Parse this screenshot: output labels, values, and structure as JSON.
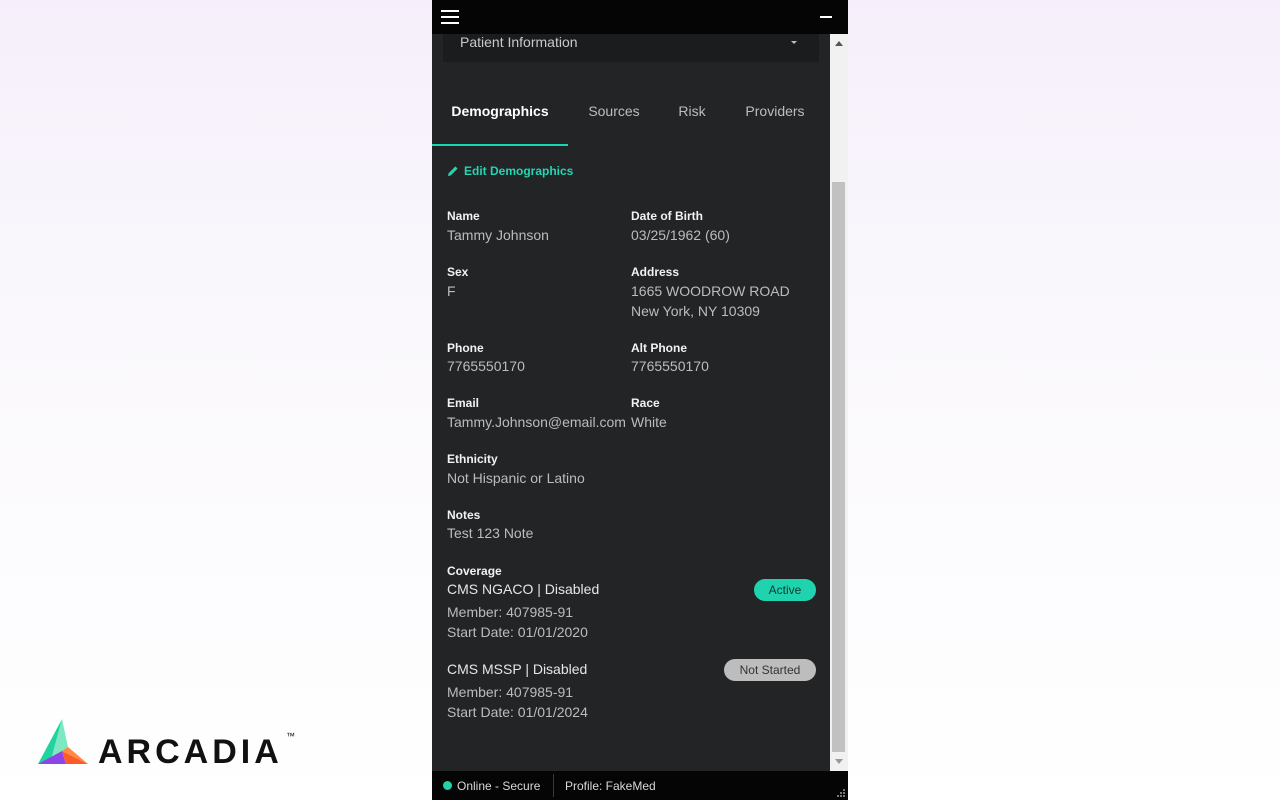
{
  "dropdown": {
    "label": "Patient Information"
  },
  "tabs": [
    {
      "label": "Demographics"
    },
    {
      "label": "Sources"
    },
    {
      "label": "Risk"
    },
    {
      "label": "Providers"
    }
  ],
  "edit_label": "Edit Demographics",
  "fields": {
    "name": {
      "label": "Name",
      "value": "Tammy Johnson"
    },
    "dob": {
      "label": "Date of Birth",
      "value": "03/25/1962 (60)"
    },
    "sex": {
      "label": "Sex",
      "value": "F"
    },
    "address": {
      "label": "Address",
      "line1": "1665 WOODROW ROAD",
      "line2": "New York, NY 10309"
    },
    "phone": {
      "label": "Phone",
      "value": "7765550170"
    },
    "alt_phone": {
      "label": "Alt Phone",
      "value": "7765550170"
    },
    "email": {
      "label": "Email",
      "value": "Tammy.Johnson@email.com"
    },
    "race": {
      "label": "Race",
      "value": "White"
    },
    "ethnicity": {
      "label": "Ethnicity",
      "value": "Not Hispanic or Latino"
    },
    "notes": {
      "label": "Notes",
      "value": "Test 123 Note"
    }
  },
  "coverage": {
    "label": "Coverage",
    "plans": [
      {
        "name": "CMS NGACO | Disabled",
        "member": "Member: 407985-91",
        "start": "Start Date: 01/01/2020",
        "status": "Active"
      },
      {
        "name": "CMS MSSP | Disabled",
        "member": "Member: 407985-91",
        "start": "Start Date: 01/01/2024",
        "status": "Not Started"
      }
    ]
  },
  "status_bar": {
    "connection": "Online - Secure",
    "profile": "Profile: FakeMed"
  },
  "brand": {
    "logo_text": "ARCADIA",
    "trademark": "™"
  },
  "colors": {
    "accent": "#1ed3ae",
    "panel_bg": "#232425",
    "titlebar_bg": "#050505"
  },
  "icons": {
    "menu": "hamburger-icon",
    "minimize": "minimize-icon",
    "edit": "pencil-icon",
    "caret": "caret-down-icon"
  }
}
